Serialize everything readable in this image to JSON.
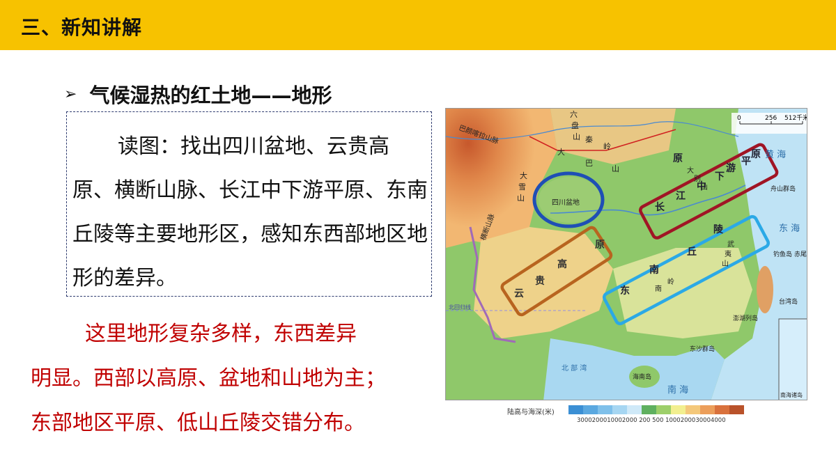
{
  "header": {
    "section_title": "三、新知讲解"
  },
  "bullet": {
    "arrow": "➢",
    "heading": "气候湿热的红土地——地形"
  },
  "task": {
    "text": "读图：找出四川盆地、云贵高原、横断山脉、长江中下游平原、东南丘陵等主要地形区，感知东西部地区地形的差异。"
  },
  "conclusion": {
    "line1": "这里地形复杂多样，东西差异",
    "line2": "明显。西部以高原、盆地和山地为主；",
    "line3": "东部地区平原、低山丘陵交错分布。"
  },
  "map": {
    "scale": {
      "zero": "0",
      "mid": "256",
      "max": "512千米"
    },
    "labels": {
      "sichuan_basin": "四川盆地",
      "yungui": [
        "云",
        "贵",
        "高",
        "原"
      ],
      "changjiang": [
        "长",
        "江",
        "中",
        "下",
        "游",
        "平",
        "原"
      ],
      "southeast": [
        "东",
        "南",
        "丘",
        "陵"
      ],
      "hengduan": "横断山脉",
      "bayankala": "巴颜喀拉山脉",
      "qinling": [
        "秦",
        "岭"
      ],
      "liupan": [
        "六",
        "盘",
        "山"
      ],
      "daba": [
        "大",
        "巴",
        "山"
      ],
      "daxue": [
        "大",
        "雪",
        "山"
      ],
      "wuyi": [
        "武",
        "夷",
        "山"
      ],
      "nanling": [
        "南",
        "岭"
      ],
      "dabie": [
        "大",
        "别",
        "山"
      ],
      "yuan": "原",
      "huanghai": "黄  海",
      "donghai": "东  海",
      "nanhai": "南  海",
      "beibuwan": "北 部 湾",
      "hainan": "海南岛",
      "taiwan": "台湾岛",
      "zhoushan": "舟山群岛",
      "diaoyu": "钓鱼岛",
      "chiwei": "赤尾屿",
      "penghu": "澎湖列岛",
      "dongsha": "东沙群岛",
      "nanhai_inset": "南海诸岛",
      "beihuigui": "北回归线"
    },
    "legend": {
      "title": "陆高与海深(米)",
      "ticks": "3000200010002000    200  500 1000200030004000",
      "colors": [
        "#3b8fd4",
        "#5aa8e0",
        "#7fc0ea",
        "#a6d6f2",
        "#cfe9f8",
        "#5fb05f",
        "#9dcf6a",
        "#f2ef8f",
        "#f4c87a",
        "#ec9e5a",
        "#d9713c",
        "#b9522a"
      ]
    },
    "highlight_colors": {
      "sichuan": "#1f4fb5",
      "yungui": "#b8641f",
      "changjiang": "#a01525",
      "southeast": "#2ba9e6"
    }
  }
}
